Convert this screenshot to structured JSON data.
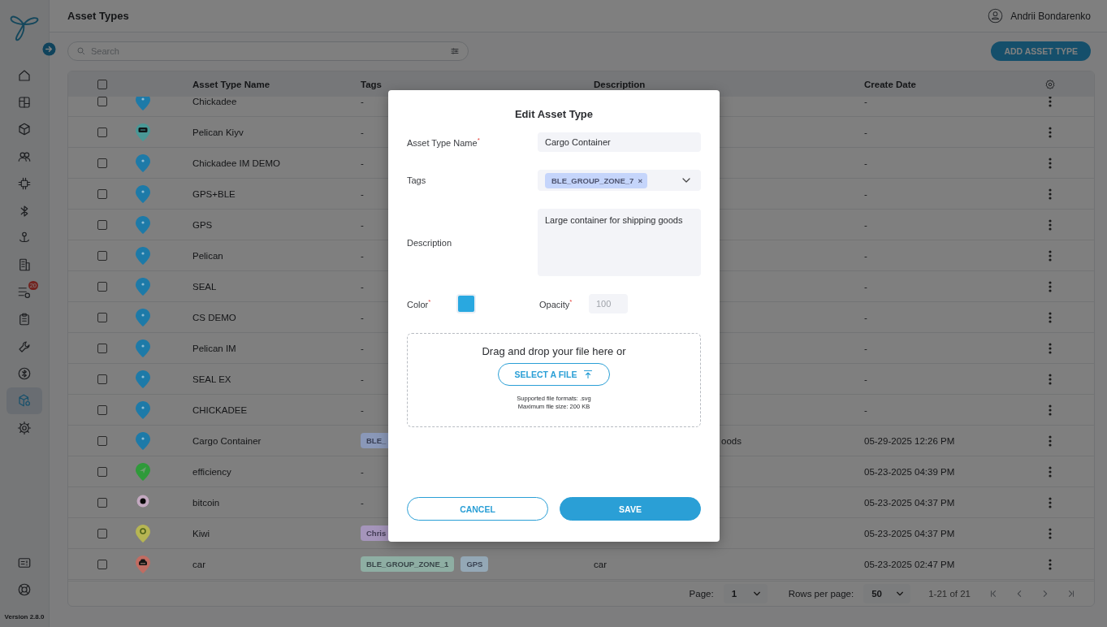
{
  "sidebar": {
    "items": [
      {
        "kind": "home",
        "selected": false
      },
      {
        "kind": "dashboard",
        "selected": false
      },
      {
        "kind": "cube",
        "selected": false
      },
      {
        "kind": "users",
        "selected": false
      },
      {
        "kind": "chip",
        "selected": false
      },
      {
        "kind": "bluetooth",
        "selected": false
      },
      {
        "kind": "person-pin",
        "selected": false
      },
      {
        "kind": "building",
        "selected": false
      },
      {
        "kind": "list",
        "selected": false,
        "badge": "20"
      },
      {
        "kind": "clipboard",
        "selected": false
      },
      {
        "kind": "wrench",
        "selected": false
      },
      {
        "kind": "bluetooth-circle",
        "selected": false
      },
      {
        "kind": "cube-gear",
        "selected": true
      },
      {
        "kind": "gear",
        "selected": false
      }
    ],
    "bottom_items": [
      {
        "kind": "info-card"
      },
      {
        "kind": "lifebuoy"
      }
    ],
    "version": "Version 2.8.0"
  },
  "header": {
    "title": "Asset Types",
    "user": "Andrii Bondarenko"
  },
  "toolbar": {
    "search": {
      "placeholder": "Search"
    },
    "add_button": "ADD ASSET TYPE"
  },
  "table": {
    "header_checkbox": {
      "checked": false
    },
    "columns": [
      "Asset Type Name",
      "Tags",
      "Description",
      "Create Date"
    ],
    "rows": [
      {
        "checked": false,
        "kind": "pin",
        "color": "#1d7aa8",
        "name": "Chickadee",
        "tags": "-",
        "create_date": "-"
      },
      {
        "checked": false,
        "kind": "device",
        "color": "#4a9896",
        "name": "Pelican Kiyv",
        "tags": "-",
        "create_date": "-"
      },
      {
        "checked": false,
        "kind": "pin",
        "color": "#1d7aa8",
        "name": "Chickadee IM DEMO",
        "tags": "-",
        "create_date": "-"
      },
      {
        "checked": false,
        "kind": "pin",
        "color": "#1d7aa8",
        "name": "GPS+BLE",
        "tags": "-",
        "create_date": "-"
      },
      {
        "checked": false,
        "kind": "pin",
        "color": "#1d7aa8",
        "name": "GPS",
        "tags": "-",
        "create_date": "-"
      },
      {
        "checked": false,
        "kind": "pin",
        "color": "#1d7aa8",
        "name": "Pelican",
        "tags": "-",
        "create_date": "-"
      },
      {
        "checked": false,
        "kind": "pin",
        "color": "#1d7aa8",
        "name": "SEAL",
        "tags": "-",
        "create_date": "-"
      },
      {
        "checked": false,
        "kind": "pin",
        "color": "#1d7aa8",
        "name": "CS DEMO",
        "tags": "-",
        "create_date": "-"
      },
      {
        "checked": false,
        "kind": "pin",
        "color": "#1d7aa8",
        "name": "Pelican IM",
        "tags": "-",
        "create_date": "-"
      },
      {
        "checked": false,
        "kind": "pin",
        "color": "#1d7aa8",
        "name": "SEAL EX",
        "tags": "-",
        "create_date": "-"
      },
      {
        "checked": false,
        "kind": "pin",
        "color": "#1d7aa8",
        "name": "CHICKADEE",
        "tags": "-",
        "create_date": "-"
      },
      {
        "checked": false,
        "kind": "pin",
        "color": "#1d7aa8",
        "name": "Cargo Container",
        "tags": [
          {
            "label": "BLE_",
            "color": "#8a98b8"
          }
        ],
        "description": "oods",
        "description_start_hidden": true,
        "create_date": "05-29-2025 12:26 PM"
      },
      {
        "checked": false,
        "kind": "arrow",
        "color": "#2f9a3a",
        "name": "efficiency",
        "tags": "-",
        "create_date": "05-23-2025 04:39 PM"
      },
      {
        "checked": false,
        "kind": "coin",
        "color": "#c2a8bf",
        "name": "bitcoin",
        "tags": "-",
        "create_date": "05-23-2025 04:37 PM"
      },
      {
        "checked": false,
        "kind": "ring",
        "color": "#b6b553",
        "name": "Kiwi",
        "tags": [
          {
            "label": "Chris",
            "color": "#a595bb"
          }
        ],
        "create_date": "05-23-2025 04:37 PM"
      },
      {
        "checked": false,
        "kind": "car",
        "color": "#c06c62",
        "name": "car",
        "tags": [
          {
            "label": "BLE_GROUP_ZONE_1",
            "color": "#8eaea3"
          },
          {
            "label": "GPS",
            "color": "#94a8b6"
          }
        ],
        "description": "car",
        "create_date": "05-23-2025 02:47 PM"
      }
    ],
    "pagination": {
      "page_label": "Page:",
      "page": "1",
      "rows_label": "Rows per page:",
      "rows_per_page": "50",
      "range": "1-21 of 21"
    }
  },
  "modal": {
    "title": "Edit Asset Type",
    "name_field": {
      "label": "Asset Type Name$^{*}$",
      "value": "Cargo Container"
    },
    "tags_field": {
      "label": "Tags",
      "tags": [
        {
          "label": "BLE_GROUP_ZONE_7",
          "remove": "×",
          "color": "#c5d5fb"
        }
      ]
    },
    "description_field": {
      "label": "Description",
      "value": "Large container for shipping goods"
    },
    "color_field": {
      "label": "Color$^{*}$",
      "color": "#29a8e0"
    },
    "opacity_field": {
      "label": "Opacity$^{*}$",
      "value": "100",
      "disabled": true
    },
    "upload": {
      "prompt": "Drag and drop your file here or",
      "button": "SELECT A FILE",
      "formats": "Supported file formats: .svg",
      "max_size": "Maximum file size: 200 KB"
    },
    "buttons": {
      "cancel": "CANCEL",
      "save": "SAVE"
    }
  }
}
